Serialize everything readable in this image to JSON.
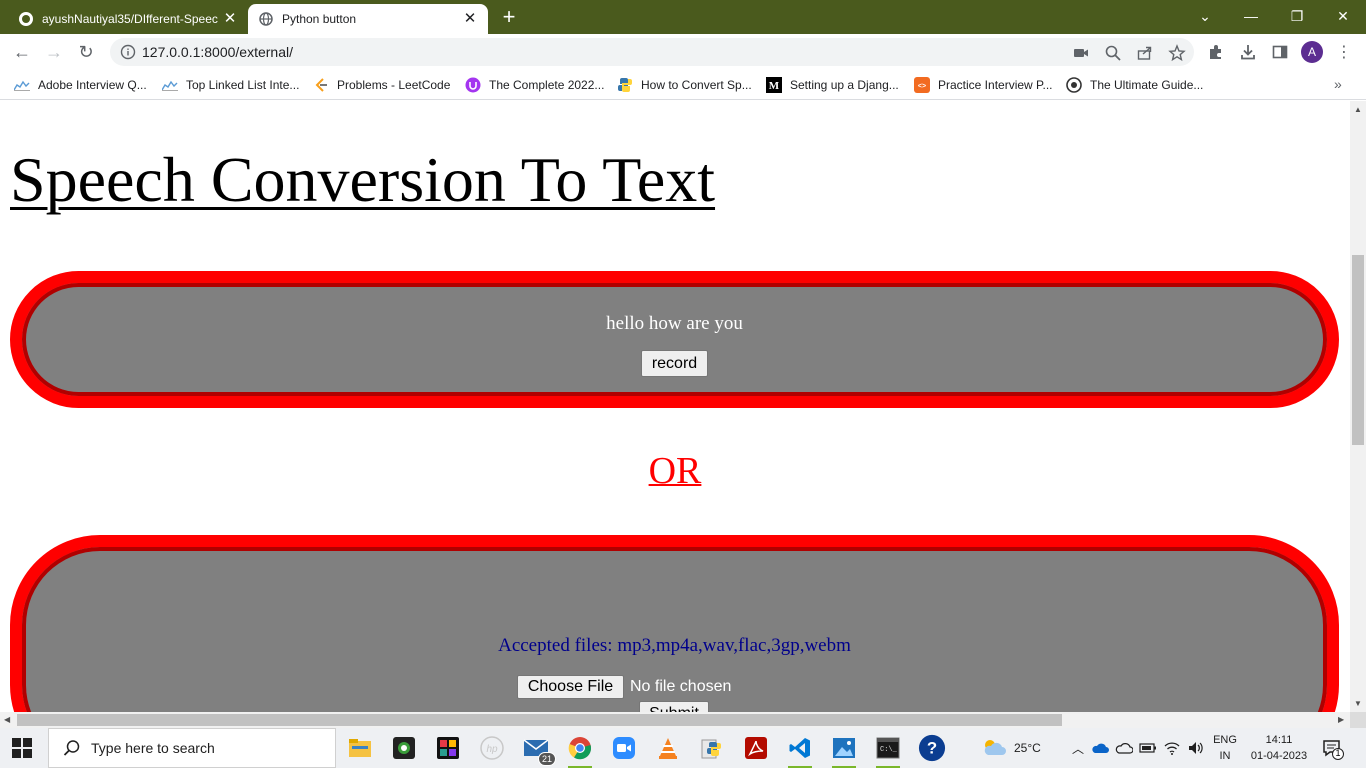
{
  "browser": {
    "tabs": [
      {
        "label": "ayushNautiyal35/DIfferent-Speec",
        "active": false,
        "favicon": "github-icon"
      },
      {
        "label": "Python button",
        "active": true,
        "favicon": "globe-icon"
      }
    ],
    "new_tab_label": "+",
    "url": "127.0.0.1:8000/external/",
    "profile_initial": "A",
    "bookmarks": [
      {
        "label": "Adobe Interview Q...",
        "icon": "chart-icon"
      },
      {
        "label": "Top Linked List Inte...",
        "icon": "chart-icon"
      },
      {
        "label": "Problems - LeetCode",
        "icon": "leetcode-icon"
      },
      {
        "label": "The Complete 2022...",
        "icon": "udemy-icon"
      },
      {
        "label": "How to Convert Sp...",
        "icon": "python-icon"
      },
      {
        "label": "Setting up a Djang...",
        "icon": "medium-icon"
      },
      {
        "label": "Practice Interview P...",
        "icon": "gfg-icon"
      },
      {
        "label": "The Ultimate Guide...",
        "icon": "guide-icon"
      }
    ]
  },
  "page": {
    "title": "Speech Conversion To Text",
    "recognized_text": "hello how are you",
    "record_label": "record",
    "or_label": "OR",
    "accepted_files": "Accepted files: mp3,mp4a,wav,flac,3gp,webm",
    "choose_file_label": "Choose File",
    "no_file_label": "No file chosen",
    "submit_label": "Submit"
  },
  "taskbar": {
    "search_placeholder": "Type here to search",
    "mail_badge": "21",
    "weather": "25°C",
    "lang_line1": "ENG",
    "lang_line2": "IN",
    "time": "14:11",
    "date": "01-04-2023",
    "notification_count": "1"
  },
  "colors": {
    "tabstrip": "#4a5a1d",
    "pill_border": "#ff0000",
    "pill_fill": "#808080",
    "or_text": "#ff0000",
    "accepted_text": "#00008b"
  }
}
